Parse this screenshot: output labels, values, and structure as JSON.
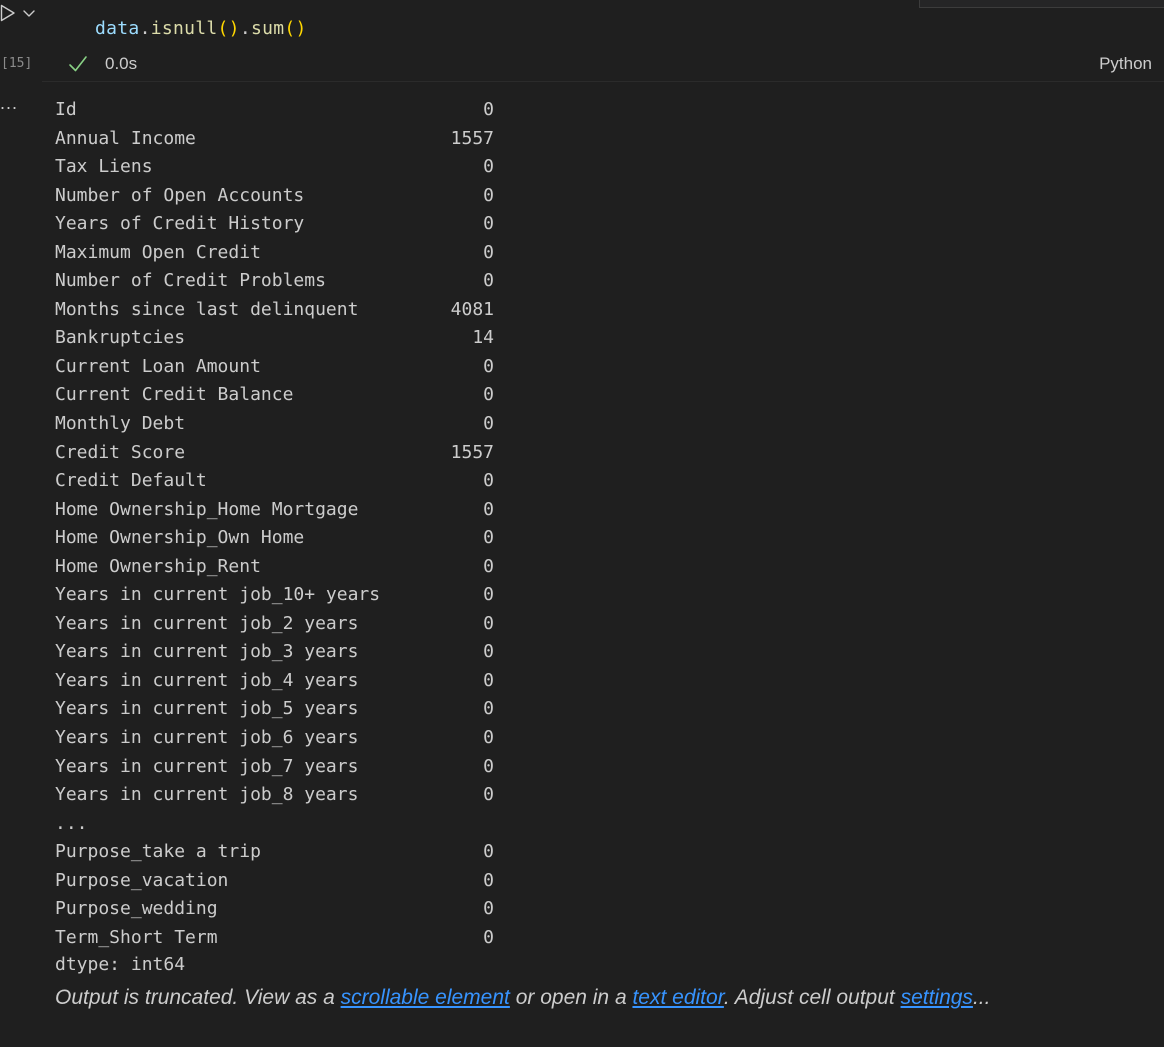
{
  "cell": {
    "code": {
      "var": "data",
      "dot1": ".",
      "fn1": "isnull",
      "paren1": "()",
      "dot2": ".",
      "fn2": "sum",
      "paren2": "()"
    },
    "execution_count": "[15]",
    "status_time": "0.0s",
    "language": "Python"
  },
  "output": {
    "ellipsis": "...",
    "rows": [
      {
        "key": "Id",
        "value": "0"
      },
      {
        "key": "Annual Income",
        "value": "1557"
      },
      {
        "key": "Tax Liens",
        "value": "0"
      },
      {
        "key": "Number of Open Accounts",
        "value": "0"
      },
      {
        "key": "Years of Credit History",
        "value": "0"
      },
      {
        "key": "Maximum Open Credit",
        "value": "0"
      },
      {
        "key": "Number of Credit Problems",
        "value": "0"
      },
      {
        "key": "Months since last delinquent",
        "value": "4081"
      },
      {
        "key": "Bankruptcies",
        "value": "14"
      },
      {
        "key": "Current Loan Amount",
        "value": "0"
      },
      {
        "key": "Current Credit Balance",
        "value": "0"
      },
      {
        "key": "Monthly Debt",
        "value": "0"
      },
      {
        "key": "Credit Score",
        "value": "1557"
      },
      {
        "key": "Credit Default",
        "value": "0"
      },
      {
        "key": "Home Ownership_Home Mortgage",
        "value": "0"
      },
      {
        "key": "Home Ownership_Own Home",
        "value": "0"
      },
      {
        "key": "Home Ownership_Rent",
        "value": "0"
      },
      {
        "key": "Years in current job_10+ years",
        "value": "0"
      },
      {
        "key": "Years in current job_2 years",
        "value": "0"
      },
      {
        "key": "Years in current job_3 years",
        "value": "0"
      },
      {
        "key": "Years in current job_4 years",
        "value": "0"
      },
      {
        "key": "Years in current job_5 years",
        "value": "0"
      },
      {
        "key": "Years in current job_6 years",
        "value": "0"
      },
      {
        "key": "Years in current job_7 years",
        "value": "0"
      },
      {
        "key": "Years in current job_8 years",
        "value": "0"
      },
      {
        "key": "...",
        "value": ""
      },
      {
        "key": "Purpose_take a trip",
        "value": "0"
      },
      {
        "key": "Purpose_vacation",
        "value": "0"
      },
      {
        "key": "Purpose_wedding",
        "value": "0"
      },
      {
        "key": "Term_Short Term",
        "value": "0"
      }
    ],
    "dtype": "dtype: int64",
    "truncation": {
      "prefix": "Output is truncated. View as a ",
      "link1": "scrollable element",
      "middle1": " or open in a ",
      "link2": "text editor",
      "middle2": ". Adjust cell output ",
      "link3": "settings",
      "suffix": "..."
    }
  },
  "colors": {
    "background": "#1f1f1f",
    "link": "#3794ff",
    "success_check": "#89d185",
    "var_token": "#9cdcfe",
    "fn_token": "#dcdcaa",
    "paren_token": "#ffd700"
  },
  "icons": {
    "run": "play-icon",
    "expand": "chevron-down-icon",
    "status": "check-icon",
    "output_actions": "ellipsis-icon"
  }
}
